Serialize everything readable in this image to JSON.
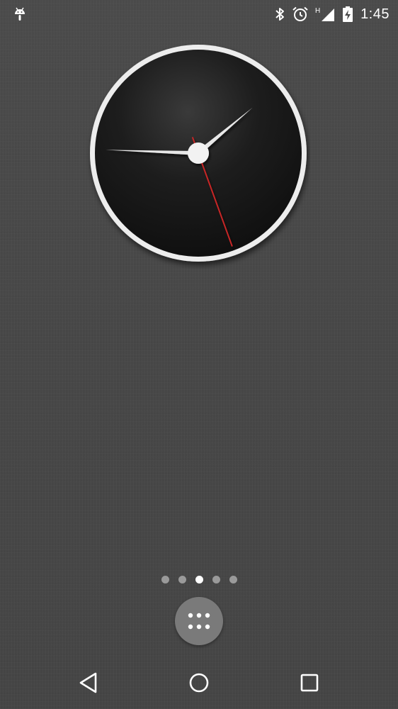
{
  "status_bar": {
    "time": "1:45",
    "network_indicator": "H",
    "icons": [
      "android-debug-icon",
      "bluetooth-icon",
      "alarm-icon",
      "cell-signal-icon",
      "battery-charging-icon"
    ]
  },
  "clock_widget": {
    "type": "analog",
    "hour_hand_angle_deg": 50,
    "minute_hand_angle_deg": 272,
    "second_hand_angle_deg": 160,
    "colors": {
      "face": "#151515",
      "ring": "#eeeeee",
      "second_hand": "#c62828"
    }
  },
  "home": {
    "page_indicator": {
      "count": 5,
      "active_index": 2
    },
    "app_drawer_icon": "apps-grid-icon"
  },
  "nav_bar": {
    "buttons": [
      "back-icon",
      "home-icon",
      "recents-icon"
    ]
  }
}
